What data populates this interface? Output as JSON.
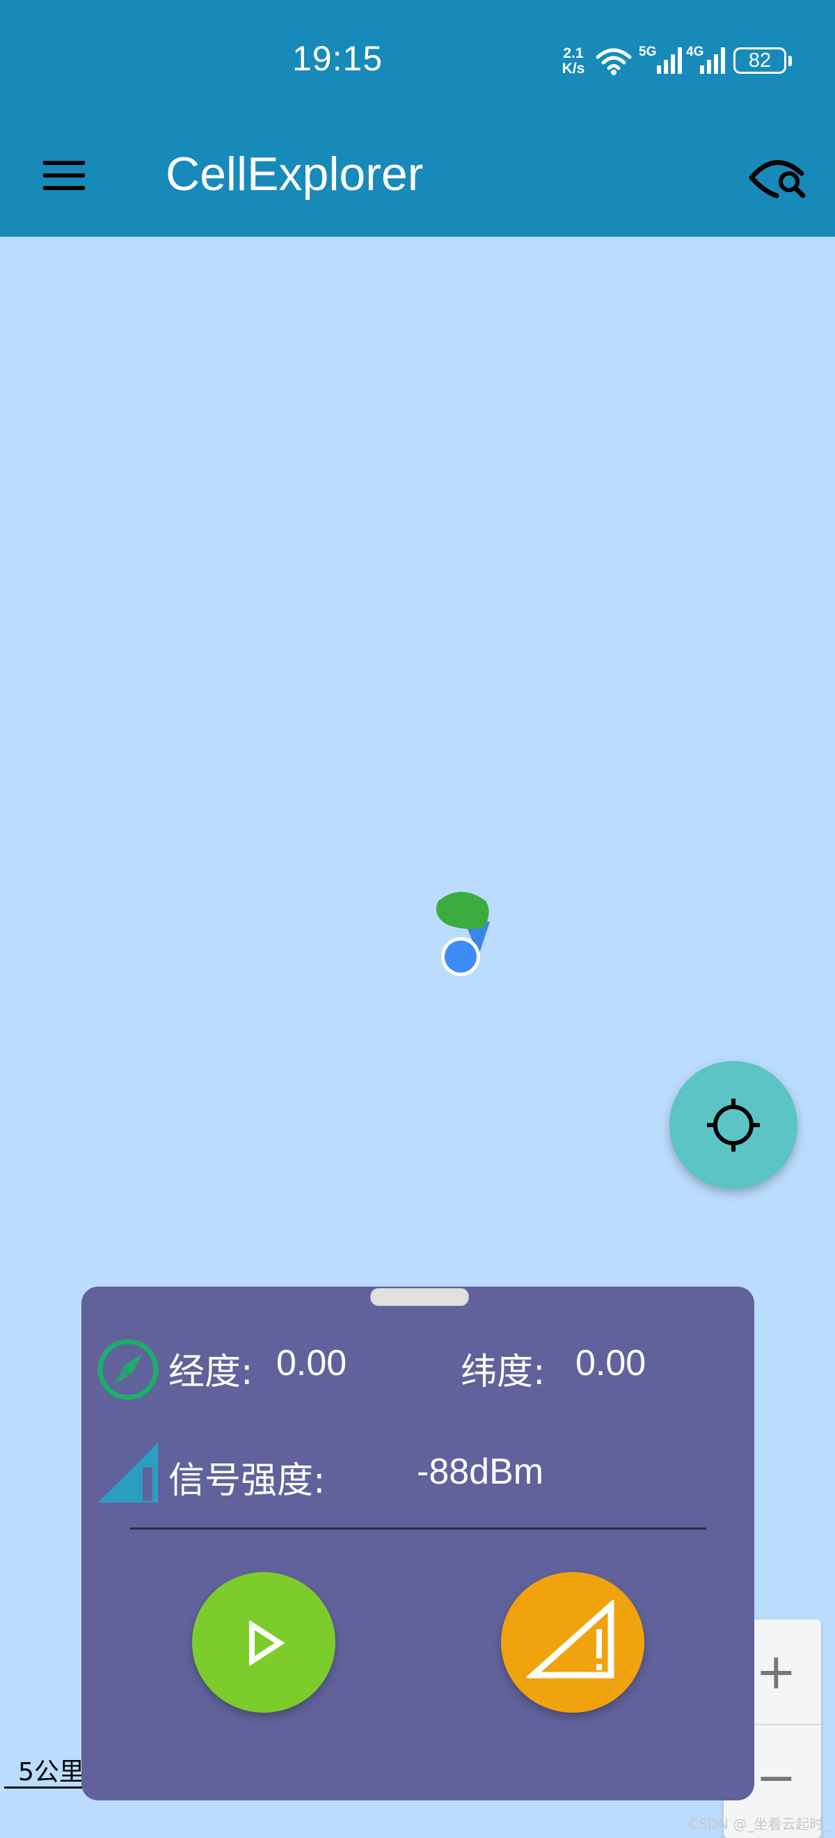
{
  "status_bar": {
    "time": "19:15",
    "net_speed_value": "2.1",
    "net_speed_unit": "K/s",
    "network_1": "5G",
    "network_2": "4G",
    "battery": "82",
    "icons": [
      "wifi-icon",
      "signal-5g-icon",
      "signal-4g-icon",
      "battery-icon"
    ]
  },
  "app_bar": {
    "title": "CellExplorer",
    "menu_icon": "hamburger-menu-icon",
    "action_icon": "eye-search-icon",
    "background": "#188aba"
  },
  "map": {
    "background": "#bcdcfd",
    "scale_label": "5公里",
    "zoom_in": "+",
    "zoom_out": "−",
    "locate_icon": "crosshair-icon"
  },
  "panel": {
    "longitude_label": "经度:",
    "longitude_value": "0.00",
    "latitude_label": "纬度:",
    "latitude_value": "0.00",
    "signal_label": "信号强度:",
    "signal_value": "-88dBm",
    "background": "#61629b",
    "start_icon": "play-icon",
    "warning_icon": "signal-warning-icon"
  },
  "watermark": "CSDN @_坐看云起时_"
}
